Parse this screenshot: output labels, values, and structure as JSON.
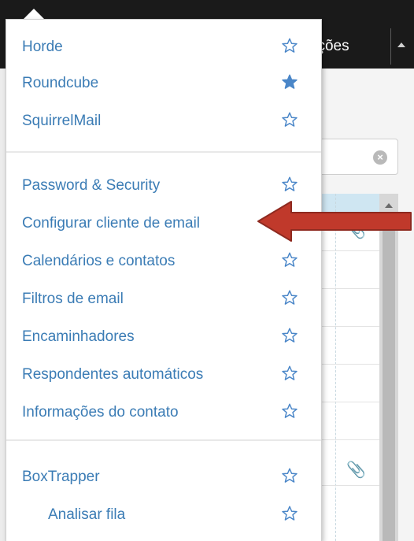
{
  "topbar": {
    "label": "urações"
  },
  "menu": {
    "items": [
      {
        "label": "Horde",
        "starred": false
      },
      {
        "label": "Roundcube",
        "starred": true
      },
      {
        "label": "SquirrelMail",
        "starred": false
      },
      {
        "label": "Password & Security",
        "starred": false
      },
      {
        "label": "Configurar cliente de email",
        "starred": null
      },
      {
        "label": "Calendários e contatos",
        "starred": false
      },
      {
        "label": "Filtros de email",
        "starred": false
      },
      {
        "label": "Encaminhadores",
        "starred": false
      },
      {
        "label": "Respondentes automáticos",
        "starred": false
      },
      {
        "label": "Informações do contato",
        "starred": false
      },
      {
        "label": "BoxTrapper",
        "starred": false
      },
      {
        "label": "Analisar fila",
        "starred": false
      }
    ]
  },
  "colors": {
    "link": "#3b7cb5",
    "star_filled": "#4a86c8",
    "arrow": "#c0392b"
  },
  "icons": {
    "star": "star-icon",
    "attachment": "paperclip-icon",
    "clear": "clear-search-icon"
  }
}
